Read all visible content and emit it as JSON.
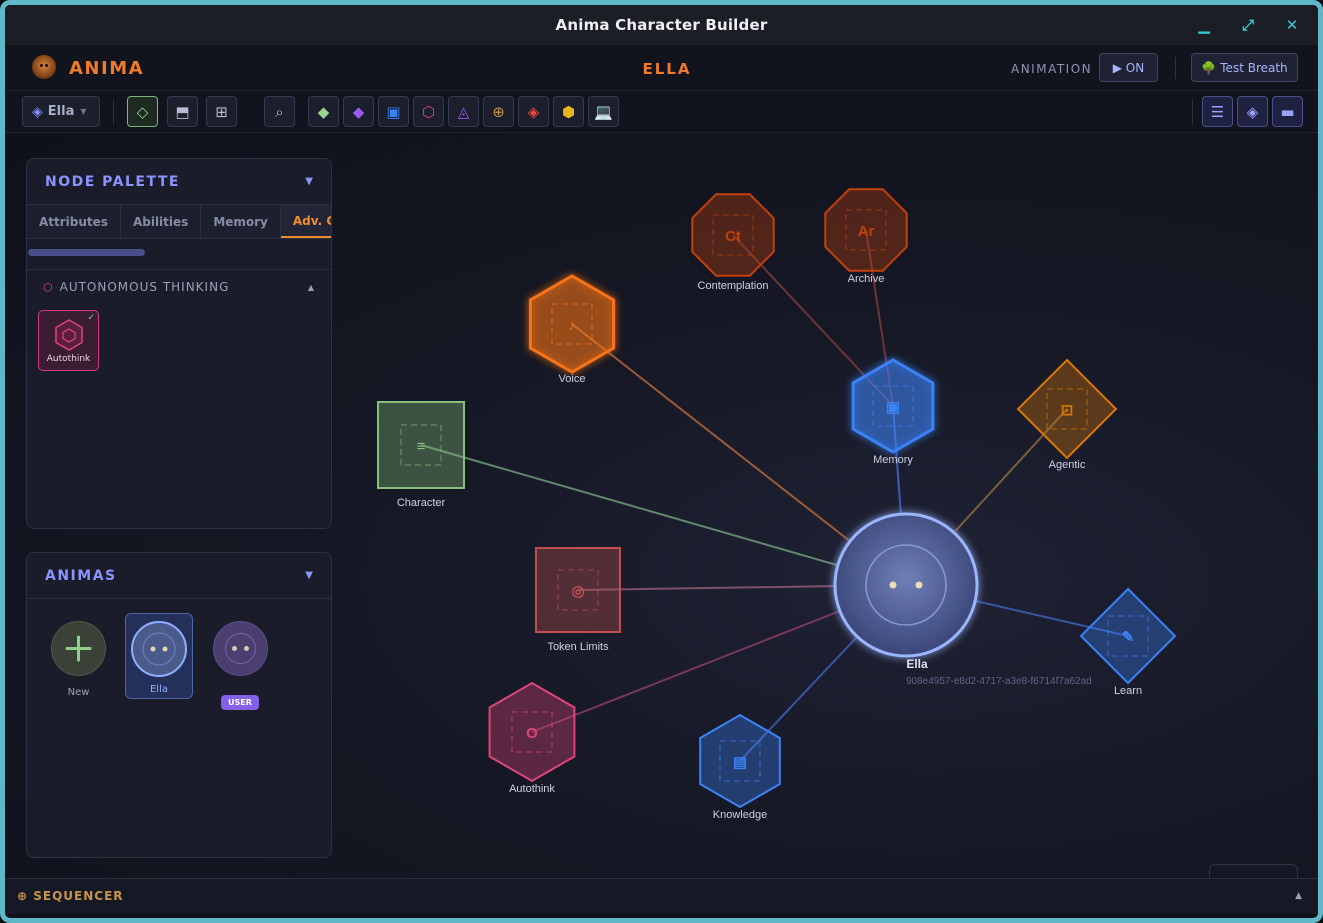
{
  "window": {
    "title": "Anima Character Builder"
  },
  "app": {
    "brand": "ANIMA",
    "character_name": "ELLA",
    "animation_label": "ANIMATION",
    "animation_toggle": "▶ ON",
    "test_breath": "Test Breath"
  },
  "toolbar": {
    "anima_select": "Ella",
    "tools": [
      {
        "name": "select-tool",
        "glyph": "◇",
        "color": "#8ed28d"
      },
      {
        "name": "save-tool",
        "glyph": "⬒",
        "color": "#b8bcd4"
      },
      {
        "name": "grid-tool",
        "glyph": "⊞",
        "color": "#b8bcd4"
      },
      {
        "name": "search-tool",
        "glyph": "⌕",
        "color": "#b8bcd4"
      }
    ],
    "node_buttons": [
      {
        "name": "attribute-node-icon",
        "glyph": "◆",
        "color": "#9bd28f"
      },
      {
        "name": "ability-node-icon",
        "glyph": "◆",
        "color": "#9a5cf0"
      },
      {
        "name": "memory-node-icon",
        "glyph": "▣",
        "color": "#3b82f6"
      },
      {
        "name": "autothink-node-icon",
        "glyph": "⬡",
        "color": "#e2457f"
      },
      {
        "name": "triangle-node-icon",
        "glyph": "◬",
        "color": "#9b59f0"
      },
      {
        "name": "target-node-icon",
        "glyph": "⊕",
        "color": "#c79449"
      },
      {
        "name": "red-diamond-node-icon",
        "glyph": "◈",
        "color": "#ef4444"
      },
      {
        "name": "hex-node-icon",
        "glyph": "⬢",
        "color": "#e8b41c"
      },
      {
        "name": "laptop-node-icon",
        "glyph": "💻",
        "color": "#7fb5f0"
      }
    ],
    "right_buttons": [
      {
        "name": "list-view-button",
        "glyph": "☰"
      },
      {
        "name": "diamond-view-button",
        "glyph": "◈"
      },
      {
        "name": "panel-view-button",
        "glyph": "▬"
      }
    ]
  },
  "palette": {
    "title": "NODE PALETTE",
    "tabs": [
      "Attributes",
      "Abilities",
      "Memory",
      "Adv. Cog"
    ],
    "active_tab": 3,
    "section": "AUTONOMOUS THINKING",
    "items": [
      {
        "label": "Autothink",
        "checked": true
      }
    ]
  },
  "animas": {
    "title": "ANIMAS",
    "items": [
      {
        "label": "New",
        "kind": "new"
      },
      {
        "label": "Ella",
        "kind": "selected"
      },
      {
        "label": "",
        "badge": "USER",
        "kind": "user"
      }
    ]
  },
  "graph": {
    "center": {
      "label": "Ella",
      "uuid": "908e4957-e8d2-4717-a3e8-f6714f7a62ad"
    },
    "nodes": [
      {
        "id": "contemplation",
        "label": "Contemplation",
        "abbr": "Ct",
        "color": "#c2410c"
      },
      {
        "id": "archive",
        "label": "Archive",
        "abbr": "Ar",
        "color": "#c2410c"
      },
      {
        "id": "voice",
        "label": "Voice",
        "abbr": "♪",
        "color": "#f97316"
      },
      {
        "id": "memory",
        "label": "Memory",
        "abbr": "▣",
        "color": "#3b82f6"
      },
      {
        "id": "agentic",
        "label": "Agentic",
        "abbr": "⊡",
        "color": "#d97706"
      },
      {
        "id": "character",
        "label": "Character",
        "abbr": "≡",
        "color": "#86c07a"
      },
      {
        "id": "token",
        "label": "Token Limits",
        "abbr": "◎",
        "color": "#c0504d"
      },
      {
        "id": "learn",
        "label": "Learn",
        "abbr": "✎",
        "color": "#3b82f6"
      },
      {
        "id": "autothink",
        "label": "Autothink",
        "abbr": "O",
        "color": "#e0457a"
      },
      {
        "id": "knowledge",
        "label": "Knowledge",
        "abbr": "▤",
        "color": "#3b82f6"
      }
    ]
  },
  "sequencer": {
    "title": "⊕ SEQUENCER"
  }
}
